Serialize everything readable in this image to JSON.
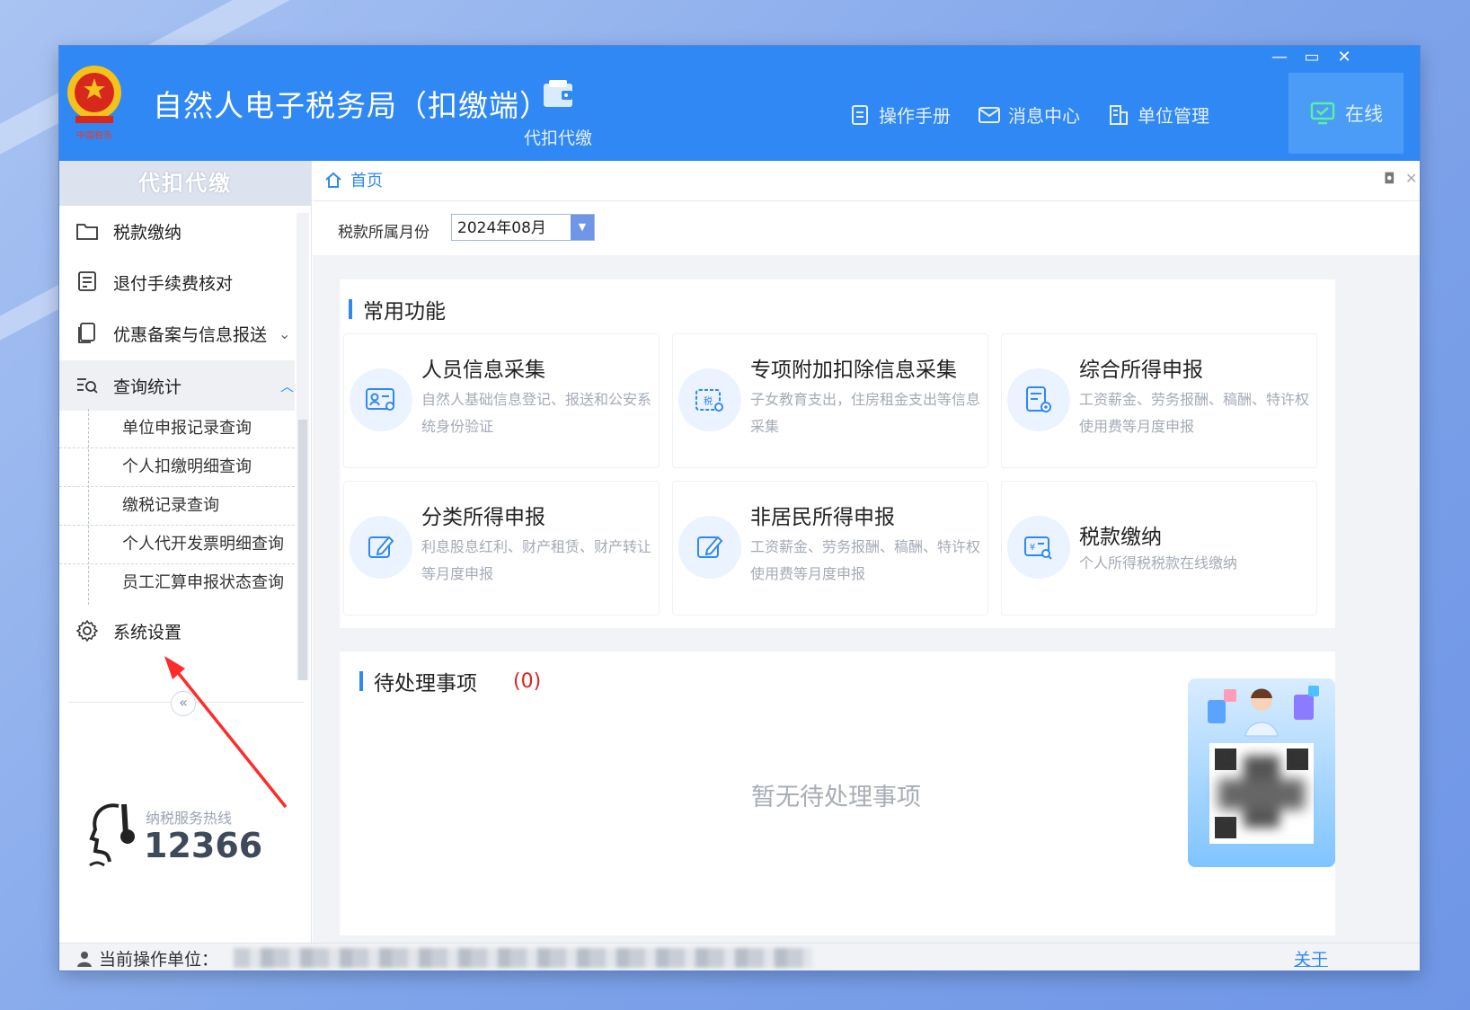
{
  "window": {
    "title": "自然人电子税务局（扣缴端）",
    "controls": {
      "minimize": "—",
      "maximize": "▭",
      "close": "✕"
    }
  },
  "header": {
    "nav_tile": {
      "label": "代扣代缴",
      "icon": "wallet-icon"
    },
    "tools": [
      {
        "label": "操作手册",
        "icon": "manual-icon"
      },
      {
        "label": "消息中心",
        "icon": "mail-icon"
      },
      {
        "label": "单位管理",
        "icon": "building-icon"
      }
    ],
    "online": {
      "label": "在线",
      "icon": "monitor-check-icon"
    }
  },
  "sidebar": {
    "title": "代扣代缴",
    "items": [
      {
        "label": "税款缴纳",
        "icon": "folder-icon"
      },
      {
        "label": "退付手续费核对",
        "icon": "list-doc-icon"
      },
      {
        "label": "优惠备案与信息报送",
        "icon": "copy-doc-icon"
      },
      {
        "label": "查询统计",
        "icon": "search-list-icon"
      },
      {
        "label": "系统设置",
        "icon": "gear-icon"
      }
    ],
    "subitems": [
      "单位申报记录查询",
      "个人扣缴明细查询",
      "缴税记录查询",
      "个人代开发票明细查询",
      "员工汇算申报状态查询"
    ],
    "collapse": "«",
    "hotline": {
      "label": "纳税服务热线",
      "number": "12366"
    }
  },
  "tabs": {
    "home": "首页",
    "restore": "◘",
    "close": "✕"
  },
  "filter": {
    "label": "税款所属月份",
    "value": "2024年08月"
  },
  "common": {
    "title": "常用功能",
    "cards": [
      {
        "title": "人员信息采集",
        "desc": "自然人基础信息登记、报送和公安系统身份验证",
        "icon": "id-card-icon"
      },
      {
        "title": "专项附加扣除信息采集",
        "desc": "子女教育支出，住房租金支出等信息采集",
        "icon": "calendar-tax-icon"
      },
      {
        "title": "综合所得申报",
        "desc": "工资薪金、劳务报酬、稿酬、特许权使用费等月度申报",
        "icon": "doc-settings-icon"
      },
      {
        "title": "分类所得申报",
        "desc": "利息股息红利、财产租赁、财产转让等月度申报",
        "icon": "edit-icon"
      },
      {
        "title": "非居民所得申报",
        "desc": "工资薪金、劳务报酬、稿酬、特许权使用费等月度申报",
        "icon": "edit-icon"
      },
      {
        "title": "税款缴纳",
        "desc": "个人所得税税款在线缴纳",
        "icon": "payment-search-icon"
      }
    ]
  },
  "pending": {
    "title": "待处理事项",
    "count": "(0)",
    "empty": "暂无待处理事项"
  },
  "status": {
    "label": "当前操作单位：",
    "about": "关于"
  },
  "colors": {
    "primary": "#2f88f4",
    "danger": "#e02020",
    "annotation_arrow": "#ff2a2a"
  }
}
